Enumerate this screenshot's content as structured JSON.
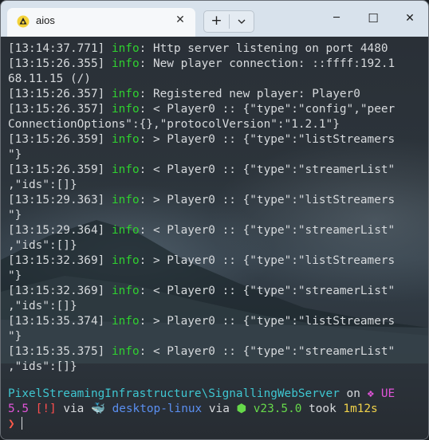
{
  "window": {
    "tab_title": "aios",
    "tab_close": "✕",
    "new_tab": "+",
    "minimize": "─",
    "maximize": "☐",
    "close": "✕"
  },
  "log_lines": [
    {
      "ts": "[13:14:37.771]",
      "level": "info",
      "msg": ": Http server listening on port 4480"
    },
    {
      "ts": "[13:15:26.355]",
      "level": "info",
      "msg": ": New player connection: ::ffff:192.1\n68.11.15 (/)"
    },
    {
      "ts": "[13:15:26.357]",
      "level": "info",
      "msg": ": Registered new player: Player0"
    },
    {
      "ts": "[13:15:26.357]",
      "level": "info",
      "msg": ": < Player0 :: {\"type\":\"config\",\"peer\nConnectionOptions\":{},\"protocolVersion\":\"1.2.1\"}"
    },
    {
      "ts": "[13:15:26.359]",
      "level": "info",
      "msg": ": > Player0 :: {\"type\":\"listStreamers\n\"}"
    },
    {
      "ts": "[13:15:26.359]",
      "level": "info",
      "msg": ": < Player0 :: {\"type\":\"streamerList\"\n,\"ids\":[]}"
    },
    {
      "ts": "[13:15:29.363]",
      "level": "info",
      "msg": ": > Player0 :: {\"type\":\"listStreamers\n\"}"
    },
    {
      "ts": "[13:15:29.364]",
      "level": "info",
      "msg": ": < Player0 :: {\"type\":\"streamerList\"\n,\"ids\":[]}"
    },
    {
      "ts": "[13:15:32.369]",
      "level": "info",
      "msg": ": > Player0 :: {\"type\":\"listStreamers\n\"}"
    },
    {
      "ts": "[13:15:32.369]",
      "level": "info",
      "msg": ": < Player0 :: {\"type\":\"streamerList\"\n,\"ids\":[]}"
    },
    {
      "ts": "[13:15:35.374]",
      "level": "info",
      "msg": ": > Player0 :: {\"type\":\"listStreamers\n\"}"
    },
    {
      "ts": "[13:15:35.375]",
      "level": "info",
      "msg": ": < Player0 :: {\"type\":\"streamerList\"\n,\"ids\":[]}"
    }
  ],
  "prompt": {
    "path": "PixelStreamingInfrastructure\\SignallingWebServer",
    "on": " on ",
    "ue_icon": "❖",
    "ue_label": " UE\n5.5 ",
    "status": "[!]",
    "via1": " via ",
    "docker_icon": "🐳",
    "docker_ctx": " desktop-linux",
    "via2": " via ",
    "node_icon": "⬢",
    "node_version": " v23.5.0",
    "took": " took ",
    "duration": "1m12s",
    "arrow": "❯"
  },
  "colors": {
    "level_info": "#2fd12f",
    "path": "#3fc6d0",
    "branch": "#e054d8",
    "status": "#ff4e4e",
    "docker": "#5a8ff0",
    "node": "#66d94a",
    "duration": "#f0d24a",
    "prompt_arrow": "#ff5a4a"
  }
}
